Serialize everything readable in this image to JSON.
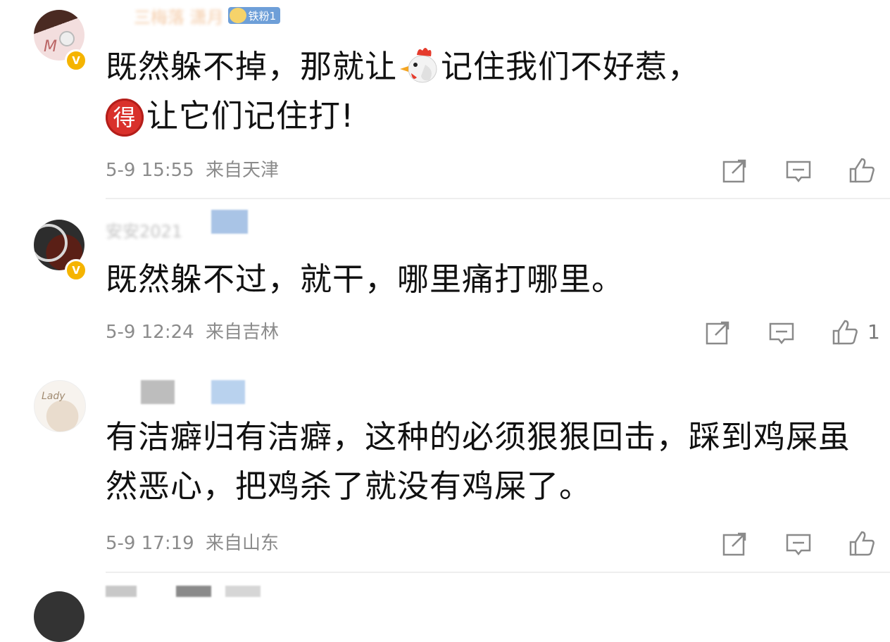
{
  "comments": [
    {
      "username": "三梅落 潇月",
      "fan_badge": "铁粉1",
      "text_before_chicken": "既然躲不掉，那就让",
      "text_after_chicken": "记住我们不好惹，",
      "de_char": "得",
      "text_line2": "让它们记住打!",
      "date": "5-9 15:55",
      "location": "来自天津",
      "like_count": ""
    },
    {
      "username": "安安2021",
      "text": "既然躲不过，就干，哪里痛打哪里。",
      "date": "5-9 12:24",
      "location": "来自吉林",
      "like_count": "1"
    },
    {
      "username": "",
      "text": "有洁癖归有洁癖，这种的必须狠狠回击，踩到鸡屎虽然恶心，把鸡杀了就没有鸡屎了。",
      "date": "5-9 17:19",
      "location": "来自山东",
      "like_count": ""
    }
  ],
  "icons": {
    "share": "share-icon",
    "comment": "comment-icon",
    "like": "thumbs-up-icon",
    "verified": "verified-v-icon",
    "chicken": "chicken-emoji-icon"
  },
  "colors": {
    "badge_gold": "#f5b400",
    "fan_badge_blue": "#6e9fd8",
    "de_red": "#d9312b",
    "meta_gray": "#8b8b8b"
  },
  "verified_mark": "V"
}
